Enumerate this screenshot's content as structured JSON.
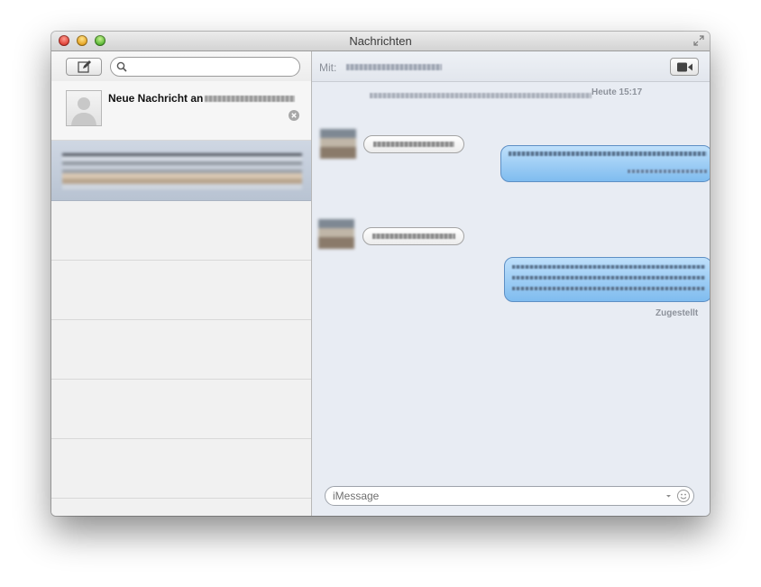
{
  "window": {
    "title": "Nachrichten"
  },
  "sidebar": {
    "search": {
      "value": "",
      "placeholder": ""
    },
    "new_conversation": {
      "title": "Neue Nachricht an"
    }
  },
  "chat": {
    "to_label": "Mit:",
    "timestamp": "Heute 15:17",
    "delivered": "Zugestellt",
    "composer": {
      "placeholder": "iMessage",
      "value": ""
    }
  },
  "icons": {
    "compose": "compose-icon",
    "search": "magnifier-icon",
    "clear": "clear-circle-icon",
    "video": "video-camera-icon",
    "emoji": "smiley-icon",
    "fullscreen": "fullscreen-arrows-icon"
  },
  "colors": {
    "outgoing_bubble": "#8cc5f3",
    "selection": "#c3ccd9",
    "chat_background": "#e8ecf3"
  }
}
